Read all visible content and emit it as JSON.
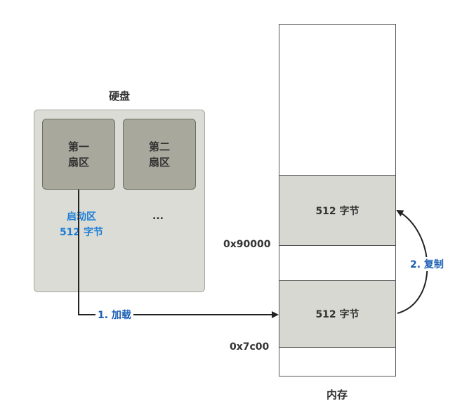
{
  "disk": {
    "title": "硬盘",
    "sector1_line1": "第一",
    "sector1_line2": "扇区",
    "sector2_line1": "第二",
    "sector2_line2": "扇区",
    "boot_line1": "启动区",
    "boot_line2": "512 字节",
    "ellipsis": "..."
  },
  "memory": {
    "title": "内存",
    "block_upper": "512 字节",
    "block_lower": "512 字节",
    "addr_upper": "0x90000",
    "addr_lower": "0x7c00"
  },
  "arrows": {
    "load_label": "1. 加载",
    "copy_label": "2. 复制"
  },
  "colors": {
    "blue": "#1b5fb4",
    "boot_blue": "#1c7ed6",
    "text": "#333333"
  }
}
